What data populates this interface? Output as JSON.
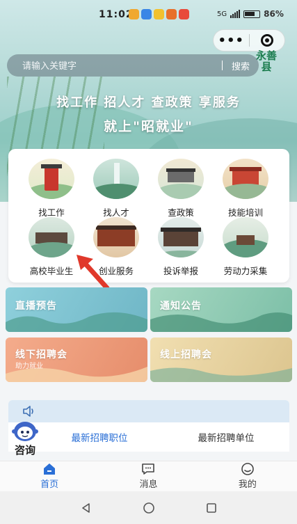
{
  "status_bar": {
    "time": "11:02",
    "network": "5G",
    "battery": "86%"
  },
  "capsule": {
    "more_label": "•••"
  },
  "county_seal": "永善县",
  "search": {
    "placeholder": "请输入关键字",
    "button_label": "搜索"
  },
  "banner": {
    "line1": "找工作 招人才 查政策 享服务",
    "line2": "就上\"昭就业\""
  },
  "services": [
    {
      "label": "找工作",
      "icon": "red-pavilion-icon"
    },
    {
      "label": "找人才",
      "icon": "waterfall-icon"
    },
    {
      "label": "查政策",
      "icon": "city-gate-icon"
    },
    {
      "label": "技能培训",
      "icon": "red-temple-icon"
    },
    {
      "label": "高校毕业生",
      "icon": "village-house-icon"
    },
    {
      "label": "创业服务",
      "icon": "wooden-house-icon"
    },
    {
      "label": "投诉举报",
      "icon": "wooden-hall-icon"
    },
    {
      "label": "劳动力采集",
      "icon": "mountain-lodge-icon"
    }
  ],
  "tiles": {
    "live": {
      "title": "直播预告"
    },
    "notice": {
      "title": "通知公告"
    },
    "offline": {
      "title": "线下招聘会",
      "subtitle": "助力就业"
    },
    "online": {
      "title": "线上招聘会"
    }
  },
  "notice_icon": "speaker-icon",
  "job_tabs": [
    {
      "label": "最新招聘职位",
      "active": true
    },
    {
      "label": "最新招聘单位",
      "active": false
    }
  ],
  "consult": {
    "label": "咨询"
  },
  "bottom_nav": [
    {
      "label": "首页",
      "icon": "home-icon",
      "active": true
    },
    {
      "label": "消息",
      "icon": "message-icon",
      "active": false
    },
    {
      "label": "我的",
      "icon": "profile-icon",
      "active": false
    }
  ],
  "colors": {
    "accent": "#2a6fd6",
    "tile_live": "#7fc1cf",
    "tile_notice": "#8fcab3",
    "tile_offline": "#ef9d7f",
    "tile_online": "#e9d6a5",
    "arrow": "#e0392b"
  }
}
